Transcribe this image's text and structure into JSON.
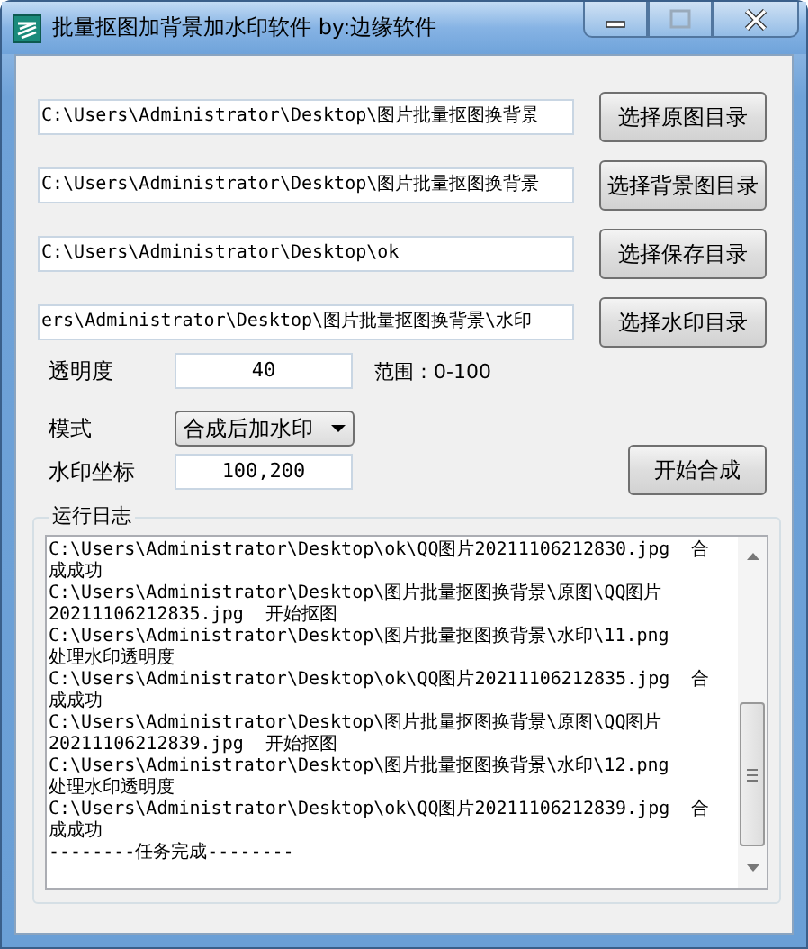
{
  "window": {
    "title": "批量抠图加背景加水印软件  by:边缘软件"
  },
  "directories": [
    {
      "path": "C:\\Users\\Administrator\\Desktop\\图片批量抠图换背景",
      "button": "选择原图目录"
    },
    {
      "path": "C:\\Users\\Administrator\\Desktop\\图片批量抠图换背景",
      "button": "选择背景图目录"
    },
    {
      "path": "C:\\Users\\Administrator\\Desktop\\ok",
      "button": "选择保存目录"
    },
    {
      "path": "ers\\Administrator\\Desktop\\图片批量抠图换背景\\水印",
      "button": "选择水印目录"
    }
  ],
  "opacity": {
    "label": "透明度",
    "value": "40",
    "hint": "范围：0-100"
  },
  "mode": {
    "label": "模式",
    "value": "合成后加水印"
  },
  "watermark_position": {
    "label": "水印坐标",
    "value": "100,200"
  },
  "start_button": "开始合成",
  "log": {
    "title": "运行日志",
    "lines": [
      "C:\\Users\\Administrator\\Desktop\\ok\\QQ图片20211106212830.jpg  合",
      "成成功",
      "C:\\Users\\Administrator\\Desktop\\图片批量抠图换背景\\原图\\QQ图片",
      "20211106212835.jpg  开始抠图",
      "C:\\Users\\Administrator\\Desktop\\图片批量抠图换背景\\水印\\11.png",
      "处理水印透明度",
      "C:\\Users\\Administrator\\Desktop\\ok\\QQ图片20211106212835.jpg  合",
      "成成功",
      "C:\\Users\\Administrator\\Desktop\\图片批量抠图换背景\\原图\\QQ图片",
      "20211106212839.jpg  开始抠图",
      "C:\\Users\\Administrator\\Desktop\\图片批量抠图换背景\\水印\\12.png",
      "处理水印透明度",
      "C:\\Users\\Administrator\\Desktop\\ok\\QQ图片20211106212839.jpg  合",
      "成成功",
      "--------任务完成--------"
    ]
  }
}
